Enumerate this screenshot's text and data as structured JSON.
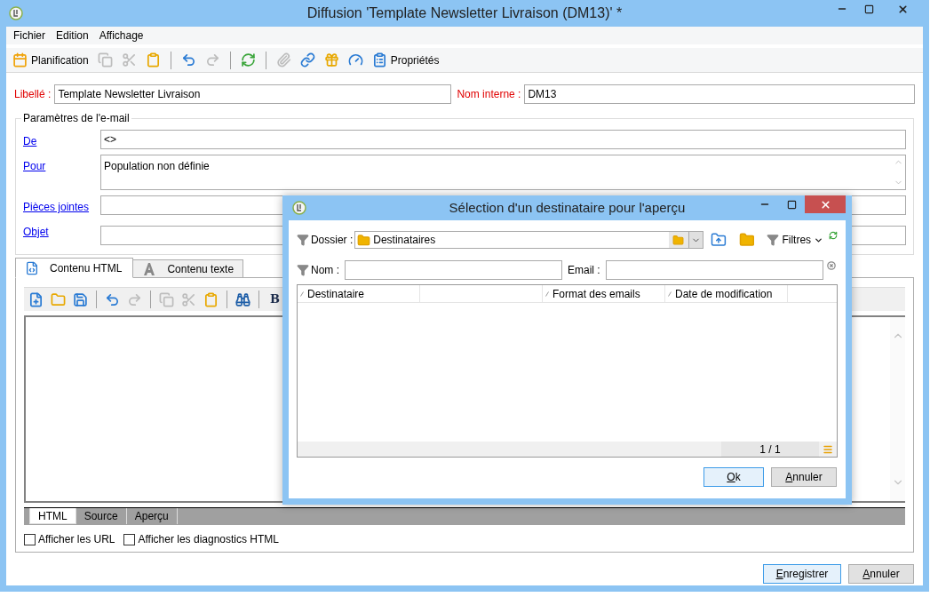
{
  "window": {
    "title": "Diffusion 'Template Newsletter Livraison (DM13)' *"
  },
  "menu": [
    "Fichier",
    "Edition",
    "Affichage"
  ],
  "toolbar": [
    {
      "kind": "calendar",
      "label": "Planification",
      "disabled": false
    },
    {
      "kind": "copy",
      "disabled": true
    },
    {
      "kind": "cut",
      "disabled": true
    },
    {
      "kind": "paste",
      "disabled": false
    },
    {
      "kind": "separator"
    },
    {
      "kind": "undo",
      "disabled": false
    },
    {
      "kind": "redo",
      "disabled": true
    },
    {
      "kind": "separator"
    },
    {
      "kind": "refresh",
      "disabled": false
    },
    {
      "kind": "separator"
    },
    {
      "kind": "attach",
      "disabled": true
    },
    {
      "kind": "link",
      "disabled": false
    },
    {
      "kind": "gift",
      "disabled": false
    },
    {
      "kind": "gauge",
      "disabled": false
    },
    {
      "kind": "properties",
      "label": "Propriétés",
      "disabled": false
    }
  ],
  "label_field": {
    "label": "Libellé :",
    "value": "Template Newsletter Livraison"
  },
  "internal_name": {
    "label": "Nom interne :",
    "value": "DM13"
  },
  "email_params": {
    "title": "Paramètres de l'e-mail",
    "rows": [
      {
        "label": "De",
        "value": "<>",
        "kind": "line"
      },
      {
        "label": "Pour",
        "value": "Population non définie",
        "kind": "area"
      },
      {
        "label": "Pièces jointes",
        "kind": "line"
      },
      {
        "label": "Objet",
        "kind": "line"
      }
    ]
  },
  "content_tabs": [
    {
      "label": "Contenu HTML",
      "kind": "html",
      "selected": true
    },
    {
      "label": "Contenu texte",
      "kind": "text",
      "selected": false
    }
  ],
  "editor_toolbar": [
    {
      "kind": "new",
      "disabled": false
    },
    {
      "kind": "open",
      "disabled": false
    },
    {
      "kind": "save",
      "disabled": false
    },
    {
      "kind": "separator"
    },
    {
      "kind": "undo",
      "disabled": false
    },
    {
      "kind": "redo",
      "disabled": true
    },
    {
      "kind": "separator"
    },
    {
      "kind": "copy",
      "disabled": true
    },
    {
      "kind": "cut",
      "disabled": true
    },
    {
      "kind": "paste",
      "disabled": false
    },
    {
      "kind": "separator"
    },
    {
      "kind": "find",
      "disabled": false
    },
    {
      "kind": "separator"
    },
    {
      "kind": "bold",
      "label": "B",
      "disabled": false
    }
  ],
  "view_tabs": [
    {
      "label": "HTML",
      "selected": true
    },
    {
      "label": "Source",
      "selected": false
    },
    {
      "label": "Aperçu",
      "selected": false
    }
  ],
  "options": [
    {
      "label": "Afficher les URL",
      "checked": false
    },
    {
      "label": "Afficher les diagnostics HTML",
      "checked": false
    }
  ],
  "buttons": [
    {
      "label": "Enregistrer",
      "default": true
    },
    {
      "label": "Annuler",
      "default": false
    }
  ],
  "dialog": {
    "title": "Sélection d'un destinataire pour l'aperçu",
    "folder": {
      "label": "Dossier :",
      "value": "Destinataires"
    },
    "filters": "Filtres",
    "name_field": {
      "label": "Nom :"
    },
    "email_field": {
      "label": "Email :"
    },
    "columns": [
      {
        "label": "Destinataire",
        "sortable": true
      },
      {
        "sortable": false
      },
      {
        "label": "Format des emails",
        "sortable": true
      },
      {
        "label": "Date de modification",
        "sortable": true
      }
    ],
    "pager": "1 / 1",
    "buttons": [
      {
        "label": "Ok",
        "default": true
      },
      {
        "label": "Annuler",
        "default": false
      }
    ]
  }
}
